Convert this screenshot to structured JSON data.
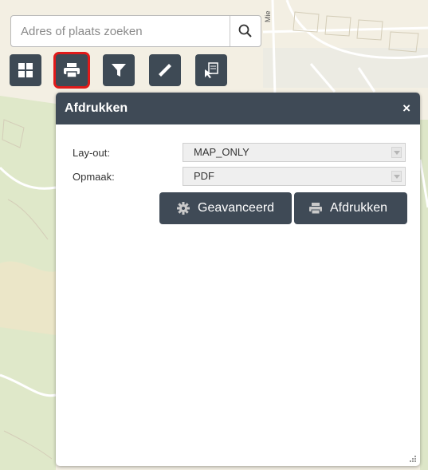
{
  "search": {
    "placeholder": "Adres of plaats zoeken",
    "icon": "search-icon"
  },
  "map": {
    "street_label": "Mie"
  },
  "toolbar": {
    "items": [
      {
        "name": "layers",
        "icon": "grid-icon",
        "active": false
      },
      {
        "name": "print",
        "icon": "printer-icon",
        "active": true
      },
      {
        "name": "filter",
        "icon": "filter-icon",
        "active": false
      },
      {
        "name": "measure",
        "icon": "ruler-icon",
        "active": false
      },
      {
        "name": "identify",
        "icon": "identify-icon",
        "active": false
      }
    ]
  },
  "panel": {
    "title": "Afdrukken",
    "close": "×",
    "layout_label": "Lay-out:",
    "layout_value": "MAP_ONLY",
    "format_label": "Opmaak:",
    "format_value": "PDF",
    "advanced_button": "Geavanceerd",
    "print_button": "Afdrukken"
  },
  "colors": {
    "accent": "#3f4a56",
    "highlight": "#e01a1a",
    "map_bg": "#f3efe3"
  }
}
